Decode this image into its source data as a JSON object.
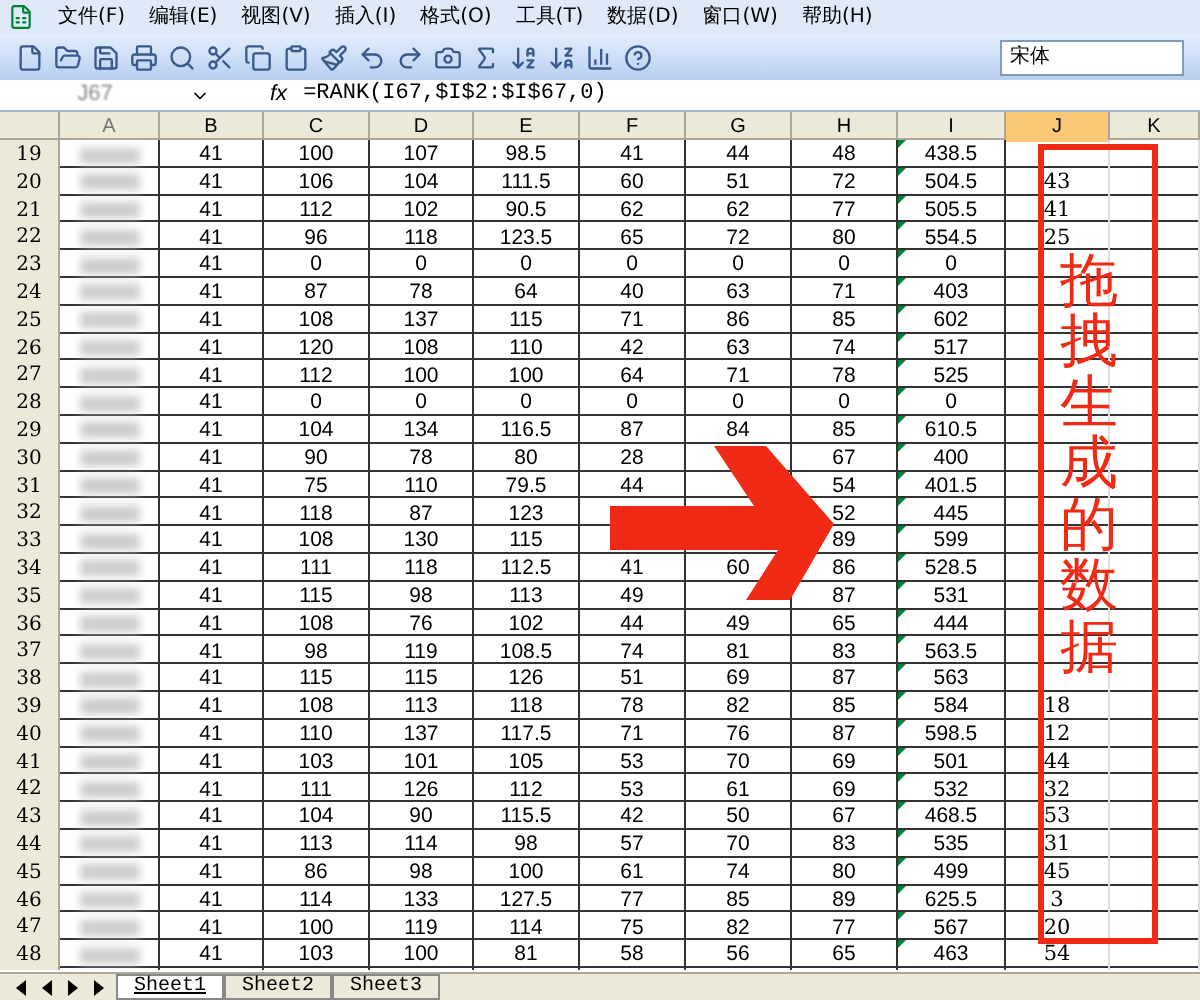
{
  "menu": [
    "文件(F)",
    "编辑(E)",
    "视图(V)",
    "插入(I)",
    "格式(O)",
    "工具(T)",
    "数据(D)",
    "窗口(W)",
    "帮助(H)"
  ],
  "font_name": "宋体",
  "name_box": "J67",
  "function_label": "fx",
  "formula": "=RANK(I67,$I$2:$I$67,0)",
  "columns": [
    {
      "label": "A",
      "selected": false
    },
    {
      "label": "B",
      "selected": false
    },
    {
      "label": "C",
      "selected": false
    },
    {
      "label": "D",
      "selected": false
    },
    {
      "label": "E",
      "selected": false
    },
    {
      "label": "F",
      "selected": false
    },
    {
      "label": "G",
      "selected": false
    },
    {
      "label": "H",
      "selected": false
    },
    {
      "label": "I",
      "selected": false
    },
    {
      "label": "J",
      "selected": true
    },
    {
      "label": "K",
      "selected": false
    }
  ],
  "rows": [
    {
      "header": "19",
      "cells": [
        "41",
        "100",
        "107",
        "98.5",
        "41",
        "44",
        "48",
        "438.5"
      ]
    },
    {
      "header": "20",
      "cells": [
        "41",
        "106",
        "104",
        "111.5",
        "60",
        "51",
        "72",
        "504.5"
      ],
      "j": "43"
    },
    {
      "header": "21",
      "cells": [
        "41",
        "112",
        "102",
        "90.5",
        "62",
        "62",
        "77",
        "505.5"
      ],
      "j": "41"
    },
    {
      "header": "22",
      "cells": [
        "41",
        "96",
        "118",
        "123.5",
        "65",
        "72",
        "80",
        "554.5"
      ],
      "j": "25"
    },
    {
      "header": "23",
      "cells": [
        "41",
        "0",
        "0",
        "0",
        "0",
        "0",
        "0",
        "0"
      ]
    },
    {
      "header": "24",
      "cells": [
        "41",
        "87",
        "78",
        "64",
        "40",
        "63",
        "71",
        "403"
      ]
    },
    {
      "header": "25",
      "cells": [
        "41",
        "108",
        "137",
        "115",
        "71",
        "86",
        "85",
        "602"
      ]
    },
    {
      "header": "26",
      "cells": [
        "41",
        "120",
        "108",
        "110",
        "42",
        "63",
        "74",
        "517"
      ]
    },
    {
      "header": "27",
      "cells": [
        "41",
        "112",
        "100",
        "100",
        "64",
        "71",
        "78",
        "525"
      ]
    },
    {
      "header": "28",
      "cells": [
        "41",
        "0",
        "0",
        "0",
        "0",
        "0",
        "0",
        "0"
      ]
    },
    {
      "header": "29",
      "cells": [
        "41",
        "104",
        "134",
        "116.5",
        "87",
        "84",
        "85",
        "610.5"
      ]
    },
    {
      "header": "30",
      "cells": [
        "41",
        "90",
        "78",
        "80",
        "28",
        null,
        "67",
        "400"
      ]
    },
    {
      "header": "31",
      "cells": [
        "41",
        "75",
        "110",
        "79.5",
        "44",
        null,
        "54",
        "401.5"
      ]
    },
    {
      "header": "32",
      "cells": [
        "41",
        "118",
        "87",
        "123",
        null,
        null,
        "52",
        "445"
      ]
    },
    {
      "header": "33",
      "cells": [
        "41",
        "108",
        "130",
        "115",
        null,
        null,
        "89",
        "599"
      ]
    },
    {
      "header": "34",
      "cells": [
        "41",
        "111",
        "118",
        "112.5",
        "41",
        "60",
        "86",
        "528.5"
      ]
    },
    {
      "header": "35",
      "cells": [
        "41",
        "115",
        "98",
        "113",
        "49",
        null,
        "87",
        "531"
      ]
    },
    {
      "header": "36",
      "cells": [
        "41",
        "108",
        "76",
        "102",
        "44",
        "49",
        "65",
        "444"
      ]
    },
    {
      "header": "37",
      "cells": [
        "41",
        "98",
        "119",
        "108.5",
        "74",
        "81",
        "83",
        "563.5"
      ]
    },
    {
      "header": "38",
      "cells": [
        "41",
        "115",
        "115",
        "126",
        "51",
        "69",
        "87",
        "563"
      ]
    },
    {
      "header": "39",
      "cells": [
        "41",
        "108",
        "113",
        "118",
        "78",
        "82",
        "85",
        "584"
      ],
      "j": "18"
    },
    {
      "header": "40",
      "cells": [
        "41",
        "110",
        "137",
        "117.5",
        "71",
        "76",
        "87",
        "598.5"
      ],
      "j": "12"
    },
    {
      "header": "41",
      "cells": [
        "41",
        "103",
        "101",
        "105",
        "53",
        "70",
        "69",
        "501"
      ],
      "j": "44"
    },
    {
      "header": "42",
      "cells": [
        "41",
        "111",
        "126",
        "112",
        "53",
        "61",
        "69",
        "532"
      ],
      "j": "32"
    },
    {
      "header": "43",
      "cells": [
        "41",
        "104",
        "90",
        "115.5",
        "42",
        "50",
        "67",
        "468.5"
      ],
      "j": "53"
    },
    {
      "header": "44",
      "cells": [
        "41",
        "113",
        "114",
        "98",
        "57",
        "70",
        "83",
        "535"
      ],
      "j": "31"
    },
    {
      "header": "45",
      "cells": [
        "41",
        "86",
        "98",
        "100",
        "61",
        "74",
        "80",
        "499"
      ],
      "j": "45"
    },
    {
      "header": "46",
      "cells": [
        "41",
        "114",
        "133",
        "127.5",
        "77",
        "85",
        "89",
        "625.5"
      ],
      "j": "3"
    },
    {
      "header": "47",
      "cells": [
        "41",
        "100",
        "119",
        "114",
        "75",
        "82",
        "77",
        "567"
      ],
      "j": "20"
    },
    {
      "header": "48",
      "cells": [
        "41",
        "103",
        "100",
        "81",
        "58",
        "56",
        "65",
        "463"
      ],
      "j": "54"
    }
  ],
  "annotation": {
    "text": "拖拽生成的数据"
  },
  "sheets": [
    {
      "label": "Sheet1",
      "selected": true
    },
    {
      "label": "Sheet2",
      "selected": false
    },
    {
      "label": "Sheet3",
      "selected": false
    }
  ]
}
